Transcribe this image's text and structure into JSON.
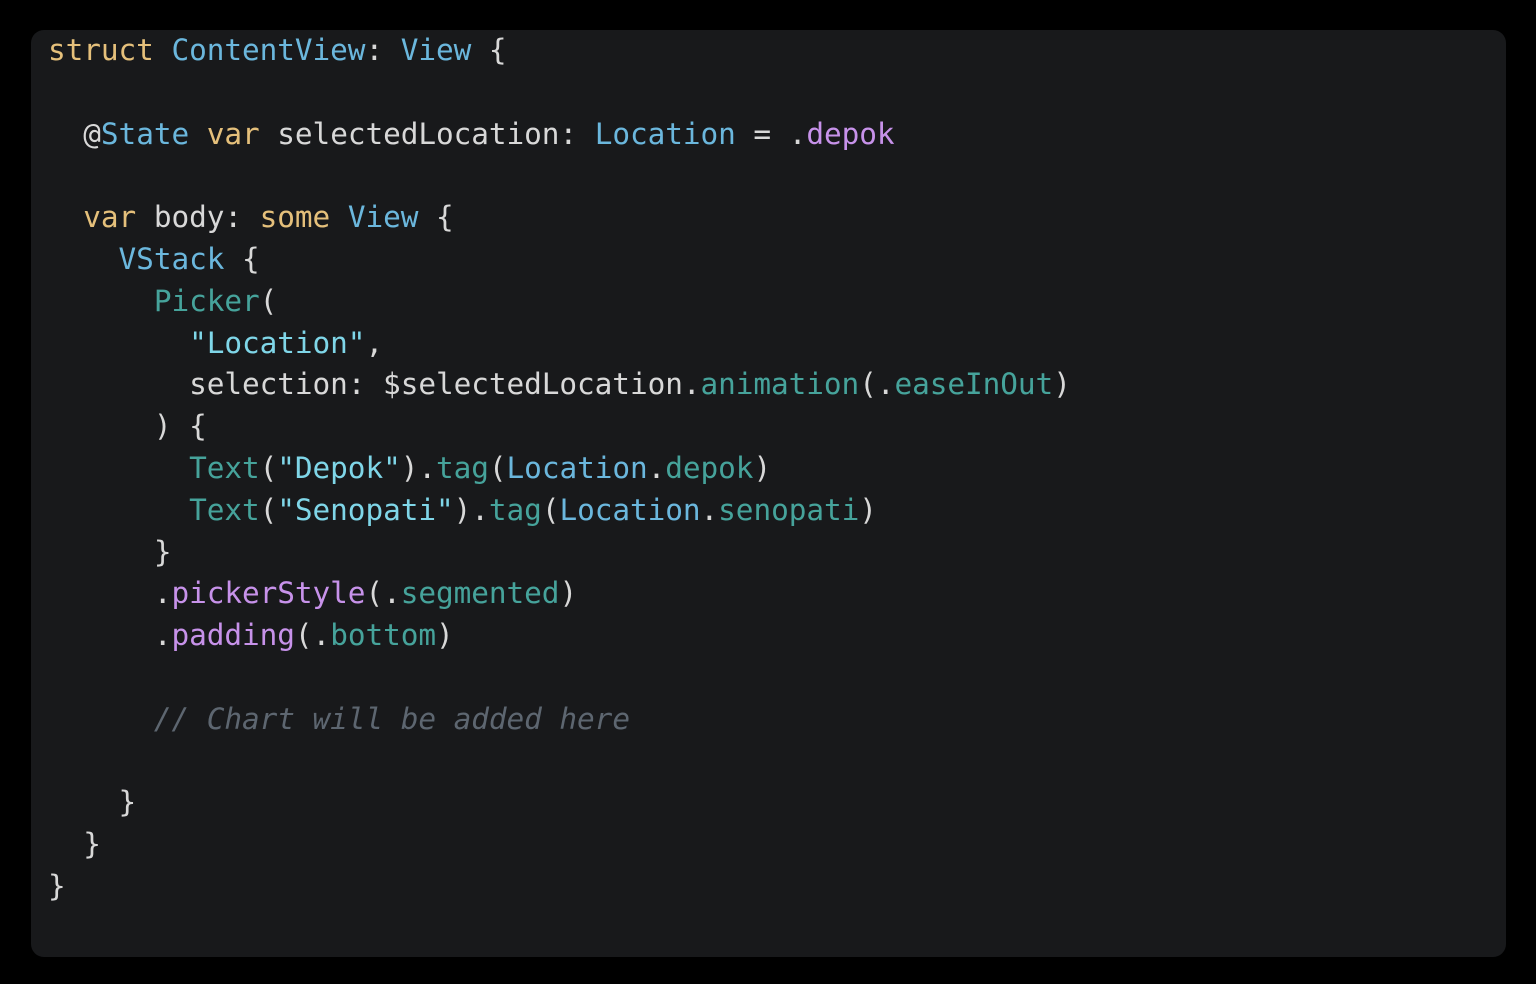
{
  "window": {
    "background_color": "#000000",
    "card_background_color": "#18191b",
    "card_corner_radius": "13px"
  },
  "editor": {
    "language": "Swift",
    "framework": "SwiftUI",
    "font_size_px": 29.4,
    "line_height_px": 41.8,
    "theme": "dark",
    "colors": {
      "plain": "#d8d8d8",
      "keyword": "#e5c07b",
      "type": "#6bb7dd",
      "attribute": "#6bb7dd",
      "string": "#7fd6e8",
      "function": "#46a39b",
      "member": "#46a39b",
      "modifier": "#c792ea",
      "comment": "#5d6670"
    }
  },
  "code": {
    "lines": [
      {
        "n": 1,
        "indent": 0,
        "tokens": [
          {
            "t": "struct",
            "c": "kw"
          },
          {
            "t": " ",
            "c": "plain"
          },
          {
            "t": "ContentView",
            "c": "type"
          },
          {
            "t": ": ",
            "c": "plain"
          },
          {
            "t": "View",
            "c": "type"
          },
          {
            "t": " {",
            "c": "plain"
          }
        ]
      },
      {
        "n": 2,
        "indent": 0,
        "tokens": []
      },
      {
        "n": 3,
        "indent": 2,
        "tokens": [
          {
            "t": "@",
            "c": "plain"
          },
          {
            "t": "State",
            "c": "attr"
          },
          {
            "t": " ",
            "c": "plain"
          },
          {
            "t": "var",
            "c": "kw"
          },
          {
            "t": " selectedLocation: ",
            "c": "plain"
          },
          {
            "t": "Location",
            "c": "type"
          },
          {
            "t": " = ",
            "c": "plain"
          },
          {
            "t": ".",
            "c": "plain"
          },
          {
            "t": "depok",
            "c": "mod"
          }
        ]
      },
      {
        "n": 4,
        "indent": 0,
        "tokens": []
      },
      {
        "n": 5,
        "indent": 2,
        "tokens": [
          {
            "t": "var",
            "c": "kw"
          },
          {
            "t": " body: ",
            "c": "plain"
          },
          {
            "t": "some",
            "c": "kw"
          },
          {
            "t": " ",
            "c": "plain"
          },
          {
            "t": "View",
            "c": "type"
          },
          {
            "t": " {",
            "c": "plain"
          }
        ]
      },
      {
        "n": 6,
        "indent": 4,
        "tokens": [
          {
            "t": "VStack",
            "c": "type"
          },
          {
            "t": " {",
            "c": "plain"
          }
        ]
      },
      {
        "n": 7,
        "indent": 6,
        "tokens": [
          {
            "t": "Picker",
            "c": "fn"
          },
          {
            "t": "(",
            "c": "plain"
          }
        ]
      },
      {
        "n": 8,
        "indent": 8,
        "tokens": [
          {
            "t": "\"Location\"",
            "c": "str"
          },
          {
            "t": ",",
            "c": "plain"
          }
        ]
      },
      {
        "n": 9,
        "indent": 8,
        "tokens": [
          {
            "t": "selection: $selectedLocation.",
            "c": "plain"
          },
          {
            "t": "animation",
            "c": "fn"
          },
          {
            "t": "(.",
            "c": "plain"
          },
          {
            "t": "easeInOut",
            "c": "member"
          },
          {
            "t": ")",
            "c": "plain"
          }
        ]
      },
      {
        "n": 10,
        "indent": 6,
        "tokens": [
          {
            "t": ") {",
            "c": "plain"
          }
        ]
      },
      {
        "n": 11,
        "indent": 8,
        "tokens": [
          {
            "t": "Text",
            "c": "fn"
          },
          {
            "t": "(",
            "c": "plain"
          },
          {
            "t": "\"Depok\"",
            "c": "str"
          },
          {
            "t": ").",
            "c": "plain"
          },
          {
            "t": "tag",
            "c": "fn"
          },
          {
            "t": "(",
            "c": "plain"
          },
          {
            "t": "Location",
            "c": "type"
          },
          {
            "t": ".",
            "c": "plain"
          },
          {
            "t": "depok",
            "c": "member"
          },
          {
            "t": ")",
            "c": "plain"
          }
        ]
      },
      {
        "n": 12,
        "indent": 8,
        "tokens": [
          {
            "t": "Text",
            "c": "fn"
          },
          {
            "t": "(",
            "c": "plain"
          },
          {
            "t": "\"Senopati\"",
            "c": "str"
          },
          {
            "t": ").",
            "c": "plain"
          },
          {
            "t": "tag",
            "c": "fn"
          },
          {
            "t": "(",
            "c": "plain"
          },
          {
            "t": "Location",
            "c": "type"
          },
          {
            "t": ".",
            "c": "plain"
          },
          {
            "t": "senopati",
            "c": "member"
          },
          {
            "t": ")",
            "c": "plain"
          }
        ]
      },
      {
        "n": 13,
        "indent": 6,
        "tokens": [
          {
            "t": "}",
            "c": "plain"
          }
        ]
      },
      {
        "n": 14,
        "indent": 6,
        "tokens": [
          {
            "t": ".",
            "c": "plain"
          },
          {
            "t": "pickerStyle",
            "c": "mod"
          },
          {
            "t": "(.",
            "c": "plain"
          },
          {
            "t": "segmented",
            "c": "member"
          },
          {
            "t": ")",
            "c": "plain"
          }
        ]
      },
      {
        "n": 15,
        "indent": 6,
        "tokens": [
          {
            "t": ".",
            "c": "plain"
          },
          {
            "t": "padding",
            "c": "mod"
          },
          {
            "t": "(.",
            "c": "plain"
          },
          {
            "t": "bottom",
            "c": "member"
          },
          {
            "t": ")",
            "c": "plain"
          }
        ]
      },
      {
        "n": 16,
        "indent": 0,
        "tokens": []
      },
      {
        "n": 17,
        "indent": 6,
        "tokens": [
          {
            "t": "// Chart will be added here",
            "c": "comment"
          }
        ]
      },
      {
        "n": 18,
        "indent": 0,
        "tokens": []
      },
      {
        "n": 19,
        "indent": 4,
        "tokens": [
          {
            "t": "}",
            "c": "plain"
          }
        ]
      },
      {
        "n": 20,
        "indent": 2,
        "tokens": [
          {
            "t": "}",
            "c": "plain"
          }
        ]
      },
      {
        "n": 21,
        "indent": 0,
        "tokens": [
          {
            "t": "}",
            "c": "plain"
          }
        ]
      }
    ],
    "plain_text": "struct ContentView: View {\n\n  @State var selectedLocation: Location = .depok\n\n  var body: some View {\n    VStack {\n      Picker(\n        \"Location\",\n        selection: $selectedLocation.animation(.easeInOut)\n      ) {\n        Text(\"Depok\").tag(Location.depok)\n        Text(\"Senopati\").tag(Location.senopati)\n      }\n      .pickerStyle(.segmented)\n      .padding(.bottom)\n\n      // Chart will be added here\n\n    }\n  }\n}"
  }
}
